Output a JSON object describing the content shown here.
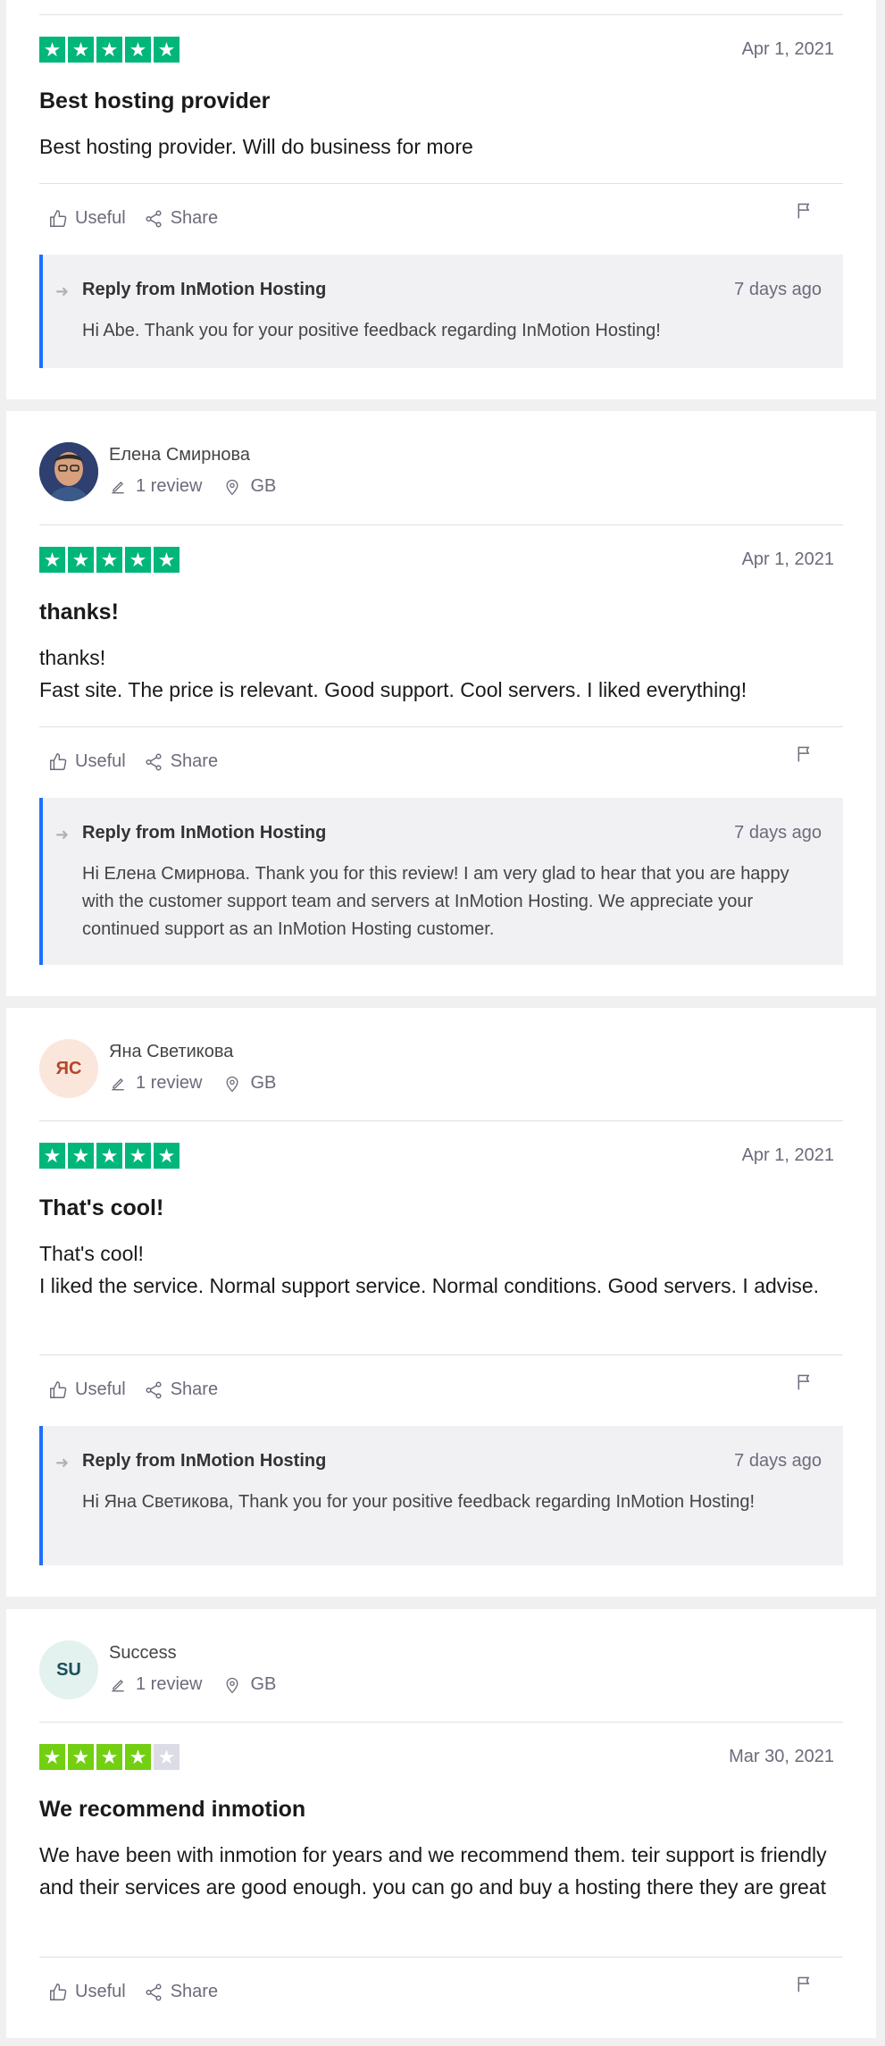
{
  "actions": {
    "useful": "Useful",
    "share": "Share"
  },
  "reviews": [
    {
      "date": "Apr 1, 2021",
      "title": "Best hosting provider",
      "text": "Best hosting provider. Will do business for more",
      "rating": 5,
      "reply": {
        "heading": "Reply from InMotion Hosting",
        "time": "7 days ago",
        "text": "Hi Abe. Thank you for your positive feedback regarding InMotion Hosting!"
      }
    },
    {
      "user": {
        "name": "Елена Смирнова",
        "reviews": "1 review",
        "country": "GB"
      },
      "date": "Apr 1, 2021",
      "title": "thanks!",
      "text": "thanks!\nFast site. The price is relevant. Good support. Cool servers. I liked everything!",
      "rating": 5,
      "reply": {
        "heading": "Reply from InMotion Hosting",
        "time": "7 days ago",
        "text": "Hi Елена Смирнова. Thank you for this review! I am very glad to hear that you are happy with the customer support team and servers at InMotion Hosting. We appreciate your continued support as an InMotion Hosting customer."
      }
    },
    {
      "user": {
        "initials": "ЯС",
        "name": "Яна Светикова",
        "reviews": "1 review",
        "country": "GB"
      },
      "date": "Apr 1, 2021",
      "title": "That's cool!",
      "text": "That's cool!\nI liked the service. Normal support service. Normal conditions. Good servers. I advise.",
      "rating": 5,
      "reply": {
        "heading": "Reply from InMotion Hosting",
        "time": "7 days ago",
        "text": "Hi Яна Светикова, Thank you for your positive feedback regarding InMotion Hosting!"
      }
    },
    {
      "user": {
        "initials": "SU",
        "name": "Success",
        "reviews": "1 review",
        "country": "GB"
      },
      "date": "Mar 30, 2021",
      "title": "We recommend inmotion",
      "text": "We have been with inmotion for years and we recommend them. teir support is friendly and their services are good enough. you can go and buy a hosting there they are great",
      "rating": 4
    }
  ],
  "colors": {
    "star_5": "#00b67a",
    "star_4": "#73cf11",
    "reply_border": "#1f6fff"
  }
}
